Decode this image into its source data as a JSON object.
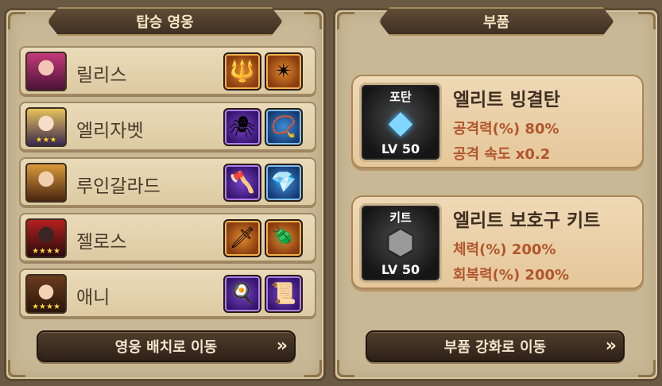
{
  "left_panel": {
    "title": "탑승 영웅",
    "heroes": [
      {
        "name": "릴리스",
        "stars": "",
        "equip": [
          "spear-icon",
          "spiked-chain-icon"
        ]
      },
      {
        "name": "엘리자벳",
        "stars": "★★★",
        "equip": [
          "spider-icon",
          "amulet-icon"
        ]
      },
      {
        "name": "루인갈라드",
        "stars": "",
        "equip": [
          "axe-icon",
          "pendant-icon"
        ]
      },
      {
        "name": "젤로스",
        "stars": "★★★★",
        "equip": [
          "curved-blade-icon",
          "beetle-icon"
        ]
      },
      {
        "name": "애니",
        "stars": "★★★★",
        "equip": [
          "mace-icon",
          "scroll-icon"
        ]
      }
    ],
    "button_label": "영웅 배치로 이동"
  },
  "right_panel": {
    "title": "부품",
    "parts": [
      {
        "tag": "포탄",
        "level": "LV 50",
        "name": "엘리트 빙결탄",
        "stat1": "공격력(%) 80%",
        "stat2": "공격 속도 x0.2"
      },
      {
        "tag": "키트",
        "level": "LV 50",
        "name": "엘리트 보호구 키트",
        "stat1": "체력(%) 200%",
        "stat2": "회복력(%) 200%"
      }
    ],
    "button_label": "부품 강화로 이동"
  },
  "button_arrow": "»"
}
